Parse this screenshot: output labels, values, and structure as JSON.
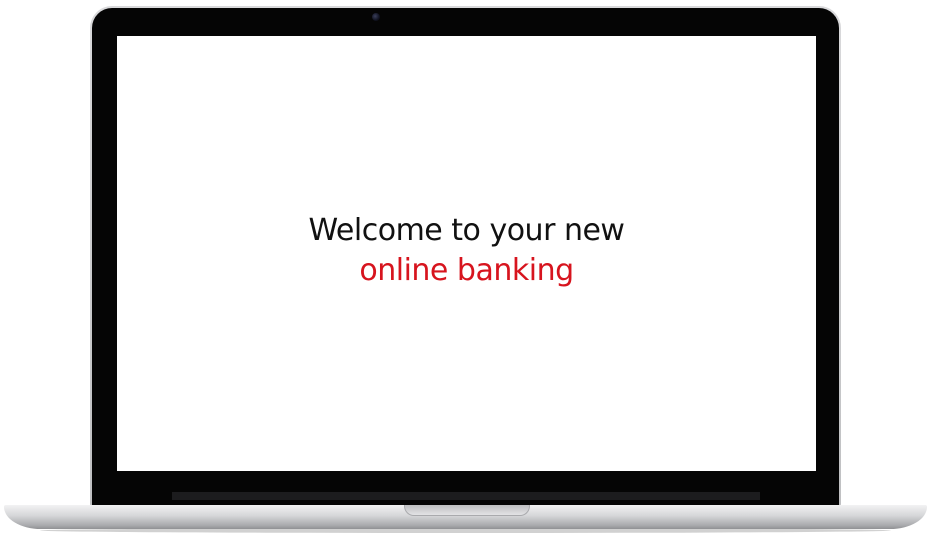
{
  "screen": {
    "headline": "Welcome to your new",
    "headline_accent": "online banking"
  },
  "colors": {
    "accent": "#d7141e",
    "text": "#111111",
    "bezel": "#050505"
  },
  "icons": {
    "camera": "webcam-icon"
  }
}
